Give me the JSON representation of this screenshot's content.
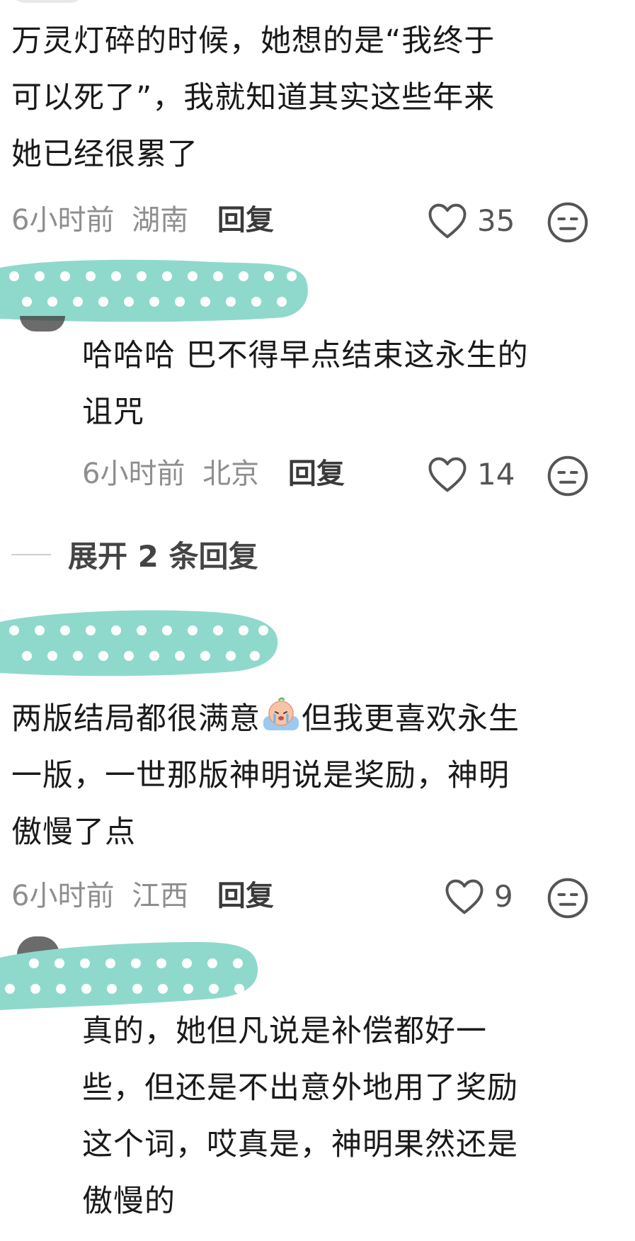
{
  "comments": [
    {
      "text": "万灵灯碎的时候，她想的是“我终于\n可以死了”，我就知道其实这些年来\n她已经很累了",
      "time": "6小时前",
      "location": "湖南",
      "reply_label": "回复",
      "likes": "35"
    },
    {
      "text": "哈哈哈 巴不得早点结束这永生的\n诅咒",
      "time": "6小时前",
      "location": "北京",
      "reply_label": "回复",
      "likes": "14"
    },
    {
      "text_part1": "两版结局都很满意",
      "text_part2": "但我更喜欢永生\n一版，一世那版神明说是奖励，神明\n傲慢了点",
      "time": "6小时前",
      "location": "江西",
      "reply_label": "回复",
      "likes": "9"
    },
    {
      "text": "真的，她但凡说是补偿都好一\n些，但还是不出意外地用了奖励\n这个词，哎真是，神明果然还是\n傲慢的"
    }
  ],
  "expand_replies": "展开 2 条回复",
  "icons": {
    "like": "heart-outline-icon",
    "reaction": "expressionless-face-icon",
    "inline_emoji": "crying-emoji-icon"
  },
  "colors": {
    "censor_blob": "#8fd9cc",
    "meta_text": "#8e8e8e"
  }
}
